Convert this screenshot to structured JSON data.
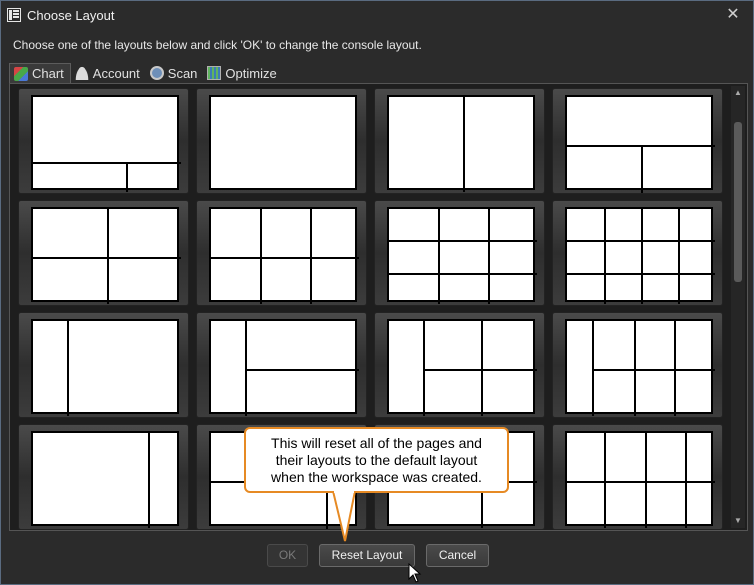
{
  "window": {
    "title": "Choose Layout",
    "close_label": "✕"
  },
  "instruction": "Choose one of the layouts below and click 'OK' to change the console layout.",
  "tabs": [
    {
      "label": "Chart",
      "icon": "chart-icon"
    },
    {
      "label": "Account",
      "icon": "account-icon"
    },
    {
      "label": "Scan",
      "icon": "scan-icon"
    },
    {
      "label": "Optimize",
      "icon": "optimize-icon"
    }
  ],
  "buttons": {
    "ok": "OK",
    "reset": "Reset Layout",
    "cancel": "Cancel"
  },
  "callout": {
    "line1": "This will reset all of the pages and",
    "line2": "their layouts to the default layout",
    "line3": "when the workspace was created."
  },
  "colors": {
    "accent_border": "#e68a24",
    "window_border": "#5a6b80"
  }
}
